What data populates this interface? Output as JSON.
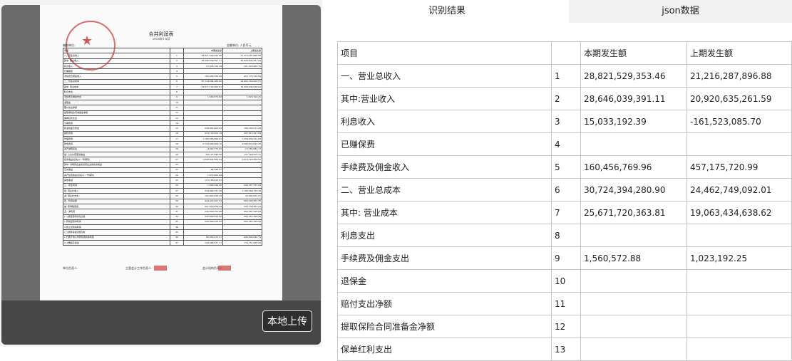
{
  "upload_button": "本地上传",
  "tabs": [
    {
      "label": "识别结果",
      "active": true
    },
    {
      "label": "json数据",
      "active": false
    }
  ],
  "document": {
    "title": "合并利润表",
    "date": "2018年1-6月",
    "meta_left": "编制单位:",
    "meta_right": "金额单位: 人民币元",
    "footer": [
      "单位负责人:",
      "主管会计工作负责人:",
      "会计机构负责人:"
    ],
    "rows": [
      [
        "项目",
        "",
        "本期发生额",
        "上期发生额"
      ],
      [
        "一、营业总收入",
        "1",
        "28,821,529,353.46",
        "21,216,287,896.88"
      ],
      [
        "其中: 营业收入",
        "2",
        "28,646,039,391.11",
        "20,920,635,261.59"
      ],
      [
        "利息收入",
        "3",
        "15,033,192.39",
        "-161,523,085.70"
      ],
      [
        "已赚保费",
        "4",
        "",
        ""
      ],
      [
        "手续费及佣金收入",
        "5",
        "160,456,769.96",
        "457,175,720.99"
      ],
      [
        "二、营业总成本",
        "6",
        "30,724,394,280.90",
        "24,462,749,092.01"
      ],
      [
        "其中: 营业成本",
        "7",
        "25,671,720,363.81",
        "19,063,434,638.62"
      ],
      [
        "利息支出",
        "8",
        "",
        ""
      ],
      [
        "手续费及佣金支出",
        "9",
        "1,560,572.88",
        "1,023,192.25"
      ],
      [
        "退保金",
        "10",
        "",
        ""
      ],
      [
        "赔付支出净额",
        "11",
        "",
        ""
      ],
      [
        "提取保险合同准备金净额",
        "12",
        "",
        ""
      ],
      [
        "保单红利支出",
        "13",
        "",
        ""
      ],
      [
        "分保费用",
        "14",
        "",
        ""
      ],
      [
        "营业税金及附加",
        "15",
        "238,952,403.63",
        "199,335,011.45"
      ],
      [
        "销售费用",
        "16",
        "223,120,202.18",
        "397,815,291.84"
      ],
      [
        "管理费用",
        "17",
        "1,700,585,909.62",
        "1,554,633,812.82"
      ],
      [
        "财务费用",
        "18",
        "2,793,998,604.70",
        "3,360,872,825.20"
      ],
      [
        "资产减值损失",
        "19",
        "-4,543,775,93",
        "-13,765,680.17"
      ],
      [
        "加: 公允价值变动收益",
        "20",
        "-62,127,040.56",
        "137,149,815.31"
      ],
      [
        "投资收益(损失以\"-\"号填列)",
        "21",
        "1,849,924,562.04",
        "2,814,743,843.95"
      ],
      [
        "其中: 对联营企业和合营企业的投资收益",
        "22",
        "",
        ""
      ],
      [
        "汇兑收益",
        "23",
        "-44,590.67",
        ""
      ],
      [
        "资产处置收益(损失以\"-\"号填列)",
        "24",
        "-7,675,963.48",
        ""
      ],
      [
        "其他收益",
        "25",
        "115,183,916.05",
        ""
      ],
      [
        "三、营业利润",
        "26",
        "-7,603,544.46",
        "-294,567,535.69"
      ],
      [
        "加: 营业外收入",
        "27",
        "554,946,781.28",
        "1,186,560,750.28"
      ],
      [
        "减: 营业外支出",
        "28",
        "102,922,829.28",
        "22,692,632.27"
      ],
      [
        "四、利润总额",
        "29",
        "444,420,407.54",
        "869,300,582.32"
      ],
      [
        "减: 所得税费用",
        "30",
        "201,619,854.56",
        "203,739,283.23"
      ],
      [
        "五、净利润",
        "31",
        "242,800,552.98",
        "665,561,299.09"
      ],
      [
        "(一)按经营持续性分类",
        "32",
        "242,800,552.98",
        "665,561,299.09"
      ],
      [
        "1.持续经营净利润",
        "33",
        "242,800,552.98",
        "665,561,299.09"
      ],
      [
        "2.终止经营净利润",
        "34",
        "",
        ""
      ],
      [
        "(二)按所有权归属分类",
        "35",
        "",
        ""
      ],
      [
        "1.归属于母公司所有者的净利润",
        "36",
        "99,552,015.21",
        "490,809,640.74"
      ],
      [
        "2.少数股东损益",
        "37",
        "143,248,537.77",
        "174,751,658.35"
      ]
    ]
  },
  "results": {
    "rows": [
      [
        "项目",
        "",
        "本期发生额",
        "上期发生额"
      ],
      [
        "一、营业总收入",
        "1",
        "28,821,529,353.46",
        "21,216,287,896.88"
      ],
      [
        "其中:营业收入",
        "2",
        "28,646,039,391.11",
        "20,920,635,261.59"
      ],
      [
        "利息收入",
        "3",
        "15,033,192.39",
        "-161,523,085.70"
      ],
      [
        "已赚保费",
        "4",
        "",
        ""
      ],
      [
        "手续费及佣金收入",
        "5",
        "160,456,769.96",
        "457,175,720.99"
      ],
      [
        "二、营业总成本",
        "6",
        "30,724,394,280.90",
        "24,462,749,092.01"
      ],
      [
        "其中: 营业成本",
        "7",
        "25,671,720,363.81",
        "19,063,434,638.62"
      ],
      [
        "利息支出",
        "8",
        "",
        ""
      ],
      [
        "手续费及佣金支出",
        "9",
        "1,560,572.88",
        "1,023,192.25"
      ],
      [
        "退保金",
        "10",
        "",
        ""
      ],
      [
        "赔付支出净额",
        "11",
        "",
        ""
      ],
      [
        "提取保险合同准备金净额",
        "12",
        "",
        ""
      ],
      [
        "保单红利支出",
        "13",
        "",
        ""
      ]
    ]
  },
  "colors": {
    "viewer_bg": "#6b6b6b",
    "viewer_shade": "#474747",
    "seal_red": "#d23c3c",
    "table_border": "#c8c8c8",
    "inactive_tab_bg": "#f2f2f2"
  }
}
